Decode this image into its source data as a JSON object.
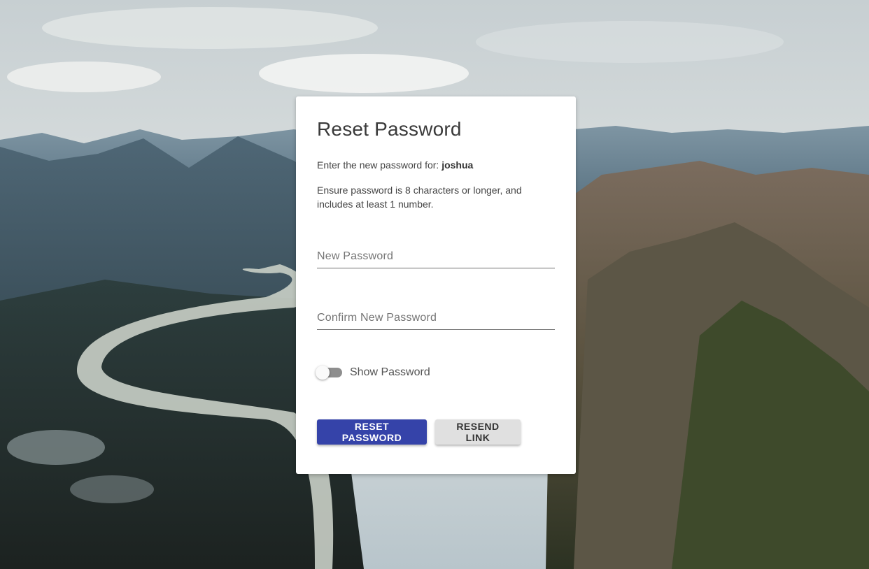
{
  "card": {
    "title": "Reset Password",
    "prompt_text": "Enter the new password for: ",
    "username": "joshua",
    "requirements_text": "Ensure password is 8 characters or longer, and includes at least 1 number."
  },
  "form": {
    "new_password": {
      "placeholder": "New Password",
      "value": ""
    },
    "confirm_password": {
      "placeholder": "Confirm New Password",
      "value": ""
    },
    "show_password": {
      "label": "Show Password",
      "checked": false
    }
  },
  "actions": {
    "reset_label": "Reset Password",
    "resend_label": "Resend Link"
  },
  "colors": {
    "primary": "#3543a9",
    "secondary": "#e0e0e0",
    "card": "#ffffff"
  }
}
